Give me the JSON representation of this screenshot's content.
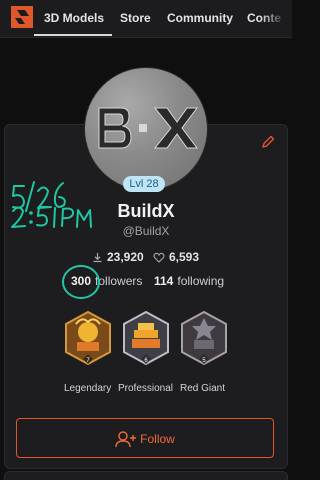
{
  "nav": {
    "items": [
      "3D Models",
      "Store",
      "Community",
      "Conte"
    ],
    "active_index": 0
  },
  "profile": {
    "level": "Lvl 28",
    "name": "BuildX",
    "handle": "@BuildX",
    "downloads": "23,920",
    "likes": "6,593",
    "followers_count": "300",
    "followers_label": "followers",
    "following_count": "114",
    "following_label": "following"
  },
  "badges": [
    {
      "label": "Legendary",
      "rank": "7"
    },
    {
      "label": "Professional",
      "rank": "6"
    },
    {
      "label": "Red Giant",
      "rank": "5"
    }
  ],
  "actions": {
    "follow_label": "Follow"
  },
  "colors": {
    "accent": "#e0582a",
    "level_bg": "#bfe4f4",
    "annotation": "#1fc7a3"
  }
}
